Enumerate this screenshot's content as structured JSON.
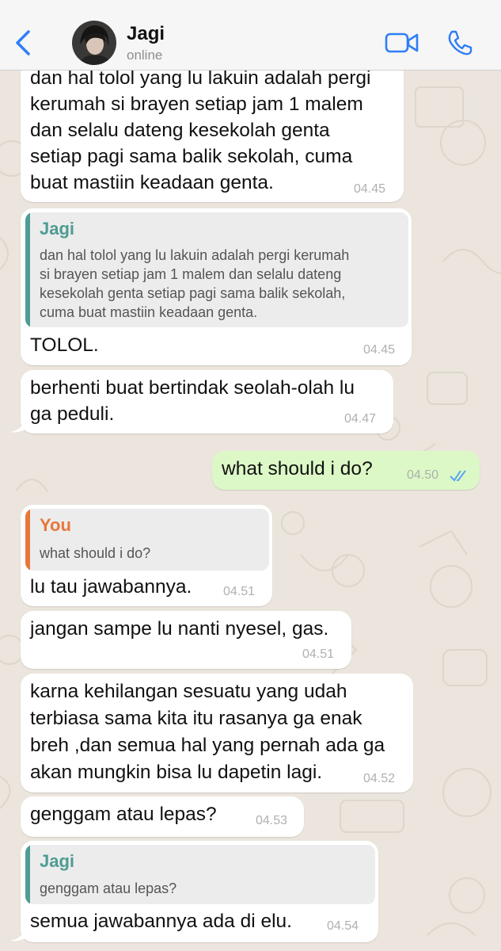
{
  "header": {
    "back_label": "",
    "contact_name": "Jagi",
    "status": "online"
  },
  "colors": {
    "incoming_bubble": "#ffffff",
    "outgoing_bubble": "#dcf8c6",
    "quote_jagi": "#4e9c93",
    "quote_you": "#e8773a",
    "ios_blue": "#2f7ef6",
    "chat_background": "#ebe5dd"
  },
  "messages": [
    {
      "direction": "incoming",
      "lines": [
        "dan hal tolol yang lu lakuin adalah pergi",
        "kerumah si brayen setiap jam 1 malem",
        "dan selalu dateng kesekolah genta",
        "setiap pagi sama balik sekolah, cuma",
        "buat mastiin keadaan genta."
      ],
      "time": "04.45"
    },
    {
      "direction": "incoming",
      "quote": {
        "author": "Jagi",
        "lines": [
          "dan hal tolol yang lu lakuin adalah pergi kerumah",
          "si brayen setiap jam 1 malem dan selalu dateng",
          "kesekolah genta setiap pagi sama balik sekolah,",
          "cuma buat mastiin keadaan genta."
        ]
      },
      "lines": [
        "TOLOL."
      ],
      "time": "04.45"
    },
    {
      "direction": "incoming",
      "lines": [
        "berhenti buat bertindak seolah-olah lu",
        "ga peduli."
      ],
      "time": "04.47"
    },
    {
      "direction": "outgoing",
      "lines": [
        "what should i do?"
      ],
      "time": "04.50",
      "read_receipt": "double-check-icon"
    },
    {
      "direction": "incoming",
      "quote": {
        "author": "You",
        "lines": [
          "what should i do?"
        ]
      },
      "lines": [
        "lu tau jawabannya."
      ],
      "time": "04.51"
    },
    {
      "direction": "incoming",
      "lines": [
        "jangan sampe lu nanti nyesel, gas."
      ],
      "time": "04.51"
    },
    {
      "direction": "incoming",
      "lines": [
        "karna kehilangan sesuatu yang udah",
        "terbiasa sama kita itu rasanya ga enak",
        "breh ,dan semua hal yang pernah ada ga",
        "akan mungkin bisa lu dapetin lagi."
      ],
      "time": "04.52"
    },
    {
      "direction": "incoming",
      "lines": [
        "genggam atau lepas?"
      ],
      "time": "04.53"
    },
    {
      "direction": "incoming",
      "quote": {
        "author": "Jagi",
        "lines": [
          "genggam atau lepas?"
        ]
      },
      "lines": [
        "semua jawabannya ada di elu."
      ],
      "time": "04.54"
    }
  ]
}
